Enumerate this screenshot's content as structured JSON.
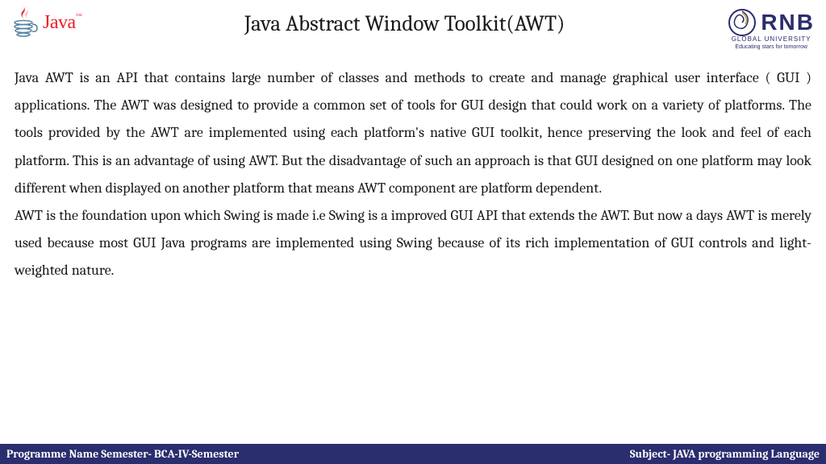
{
  "header": {
    "java_logo_text": "Java",
    "title": "Java Abstract Window Toolkit(AWT)",
    "rnb_name": "RNB",
    "rnb_sub": "GLOBAL UNIVERSITY",
    "rnb_tag": "Educating stars for tomorrow"
  },
  "content": {
    "para1": "Java AWT is an API that contains large number of classes and methods to create and manage graphical user interface ( GUI ) applications. The AWT was designed to provide a common set of tools for GUI design that could work on a variety of platforms. The tools provided by the AWT are implemented using each platform's native GUI toolkit, hence preserving the look and feel of each platform. This is an advantage of using AWT. But the disadvantage of such an approach is that GUI designed on one platform may look different when displayed on another platform that means AWT component are platform dependent.",
    "para2": "AWT is the foundation upon which Swing is made i.e Swing is a improved GUI API that extends the AWT. But now a days AWT is merely used because most GUI Java programs are implemented using Swing because of its rich implementation of GUI controls and light-weighted nature."
  },
  "footer": {
    "left": "Programme Name Semester- BCA-IV-Semester",
    "right": "Subject-  JAVA programming Language"
  }
}
